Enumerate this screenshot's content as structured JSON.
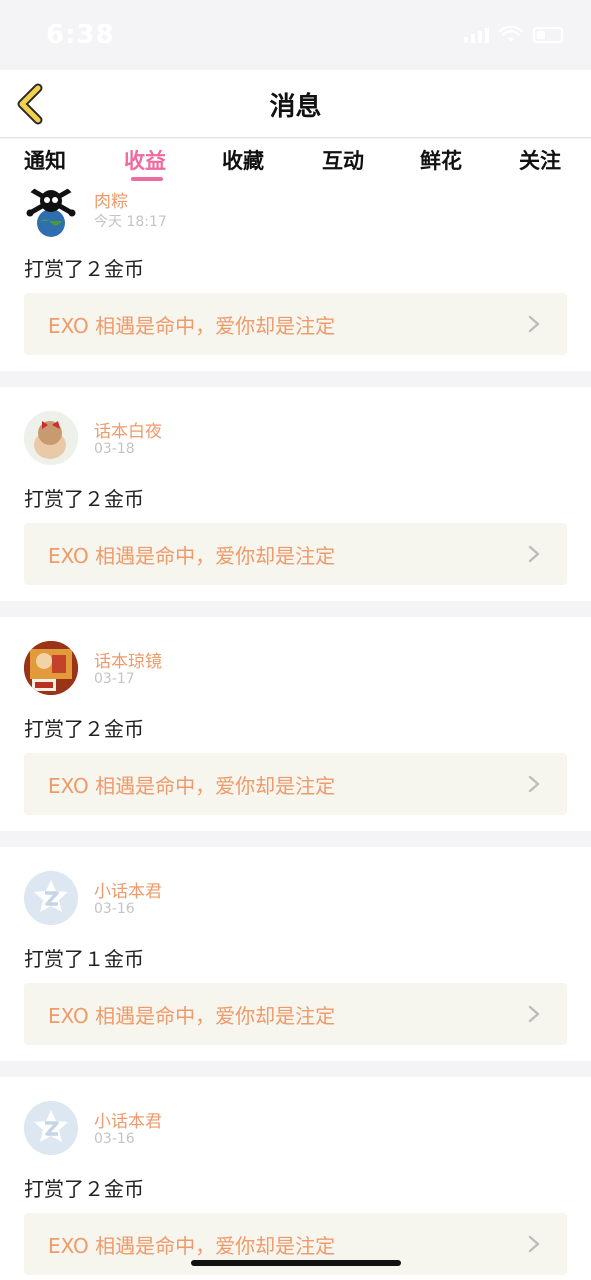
{
  "status_bar": {
    "time": "6:38"
  },
  "nav": {
    "title": "消息"
  },
  "tabs": [
    {
      "label": "通知"
    },
    {
      "label": "收益"
    },
    {
      "label": "收藏"
    },
    {
      "label": "互动"
    },
    {
      "label": "鲜花"
    },
    {
      "label": "关注"
    }
  ],
  "active_tab": "收益",
  "messages": [
    {
      "user": "肉粽",
      "date": "今天 18:17",
      "text": "打赏了２金币",
      "work": "EXO 相遇是命中，爱你却是注定"
    },
    {
      "user": "话本白夜",
      "date": "03-18",
      "text": "打赏了２金币",
      "work": "EXO 相遇是命中，爱你却是注定"
    },
    {
      "user": "话本琼镜",
      "date": "03-17",
      "text": "打赏了２金币",
      "work": "EXO 相遇是命中，爱你却是注定"
    },
    {
      "user": "小话本君",
      "date": "03-16",
      "text": "打赏了１金币",
      "work": "EXO 相遇是命中，爱你却是注定"
    },
    {
      "user": "小话本君",
      "date": "03-16",
      "text": "打赏了２金币",
      "work": "EXO 相遇是命中，爱你却是注定"
    }
  ],
  "colors": {
    "accent_pink": "#ef6aa0",
    "accent_orange": "#ef9a6a",
    "link_bg": "#f6f5ee",
    "back_arrow": "#f2d24a"
  }
}
